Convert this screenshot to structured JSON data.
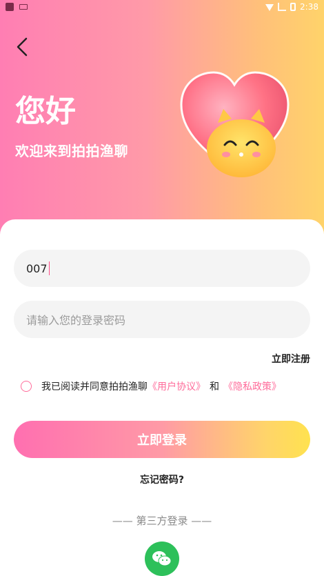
{
  "status_bar": {
    "time": "2:38",
    "icons": [
      "wifi-icon",
      "no-signal-icon",
      "battery-icon"
    ]
  },
  "header": {
    "back_icon": "chevron-left-icon",
    "greeting": "您好",
    "welcome": "欢迎来到拍拍渔聊",
    "mascot_icon": "heart-cat-mascot"
  },
  "form": {
    "account_value": "007",
    "password_placeholder": "请输入您的登录密码",
    "register_label": "立即注册"
  },
  "agreement": {
    "prefix": "我已阅读并同意拍拍渔聊",
    "user_agreement": "《用户协议》",
    "and": "和",
    "privacy_policy": "《隐私政策》"
  },
  "actions": {
    "login_label": "立即登录",
    "forgot_label": "忘记密码?"
  },
  "third_party": {
    "label": "—— 第三方登录 ——",
    "wechat_icon": "wechat-icon"
  },
  "colors": {
    "accent_pink": "#ff6b9a",
    "wechat_green": "#2dc05a"
  }
}
